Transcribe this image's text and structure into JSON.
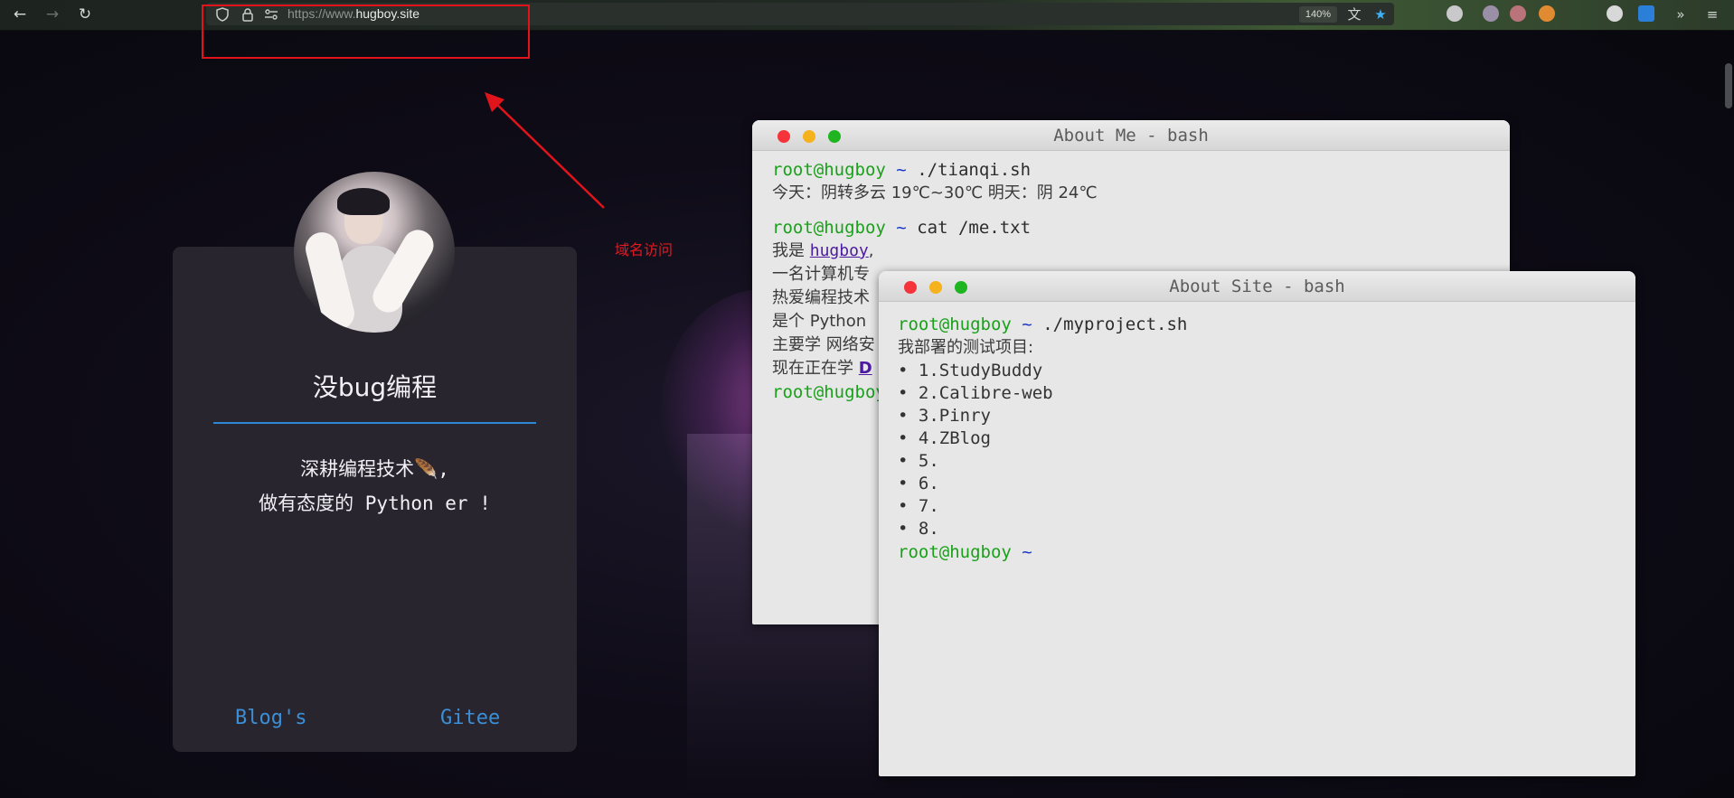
{
  "browser": {
    "url_prefix": "https://www.",
    "url_domain": "hugboy.site",
    "zoom": "140%"
  },
  "annotation": {
    "label": "域名访问"
  },
  "card": {
    "name": "没bug编程",
    "motto_line1": "深耕编程技术🪶,",
    "motto_line2": "做有态度的 Python er !",
    "link_blogs": "Blog's",
    "link_gitee": "Gitee"
  },
  "about_me": {
    "title": "About Me - bash",
    "prompt_user": "root@hugboy",
    "prompt_tilde": "~",
    "cmd1": "./tianqi.sh",
    "weather": "今天：阴转多云 19℃~30℃  明天：阴 24℃",
    "cmd2": "cat /me.txt",
    "me_prefix": "我是 ",
    "me_name": "hugboy",
    "me_suffix": ",",
    "line_a": "一名计算机专",
    "line_b": "热爱编程技术",
    "line_c": "是个 Python",
    "line_d": "主要学 网络安",
    "line_e_prefix": "现在正在学 ",
    "line_e_link": "D",
    "last_prompt": "root@hugboy"
  },
  "about_site": {
    "title": "About Site - bash",
    "prompt_user": "root@hugboy",
    "prompt_tilde": "~",
    "cmd": "./myproject.sh",
    "intro": "我部署的测试项目:",
    "items": [
      "1.StudyBuddy",
      "2.Calibre-web",
      "3.Pinry",
      "4.ZBlog",
      "5.",
      "6.",
      "7.",
      "8."
    ],
    "end_user": "root@hugboy",
    "end_tilde": "~"
  }
}
